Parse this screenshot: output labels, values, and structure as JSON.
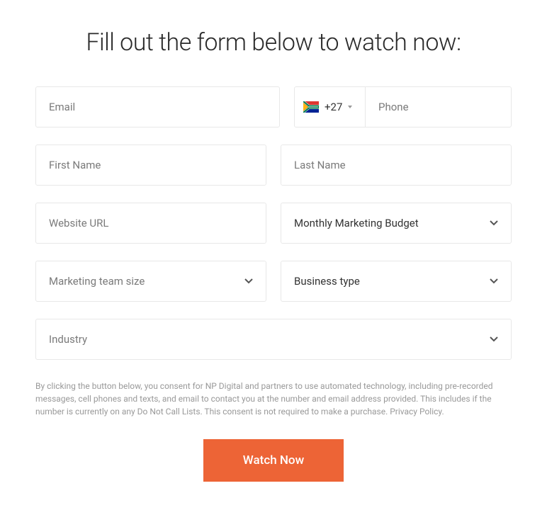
{
  "heading": "Fill out the form below to watch now:",
  "fields": {
    "email": {
      "placeholder": "Email"
    },
    "phone": {
      "country_code": "+27",
      "placeholder": "Phone"
    },
    "first_name": {
      "placeholder": "First Name"
    },
    "last_name": {
      "placeholder": "Last Name"
    },
    "website_url": {
      "placeholder": "Website URL"
    },
    "budget": {
      "label": "Monthly Marketing Budget"
    },
    "team_size": {
      "label": "Marketing team size"
    },
    "business_type": {
      "label": "Business type"
    },
    "industry": {
      "label": "Industry"
    }
  },
  "consent": "By clicking the button below, you consent for NP Digital and partners to use automated technology, including pre-recorded messages, cell phones and texts, and email to contact you at the number and email address provided. This includes if the number is currently on any Do Not Call Lists. This consent is not required to make a purchase. Privacy Policy.",
  "submit_label": "Watch Now"
}
